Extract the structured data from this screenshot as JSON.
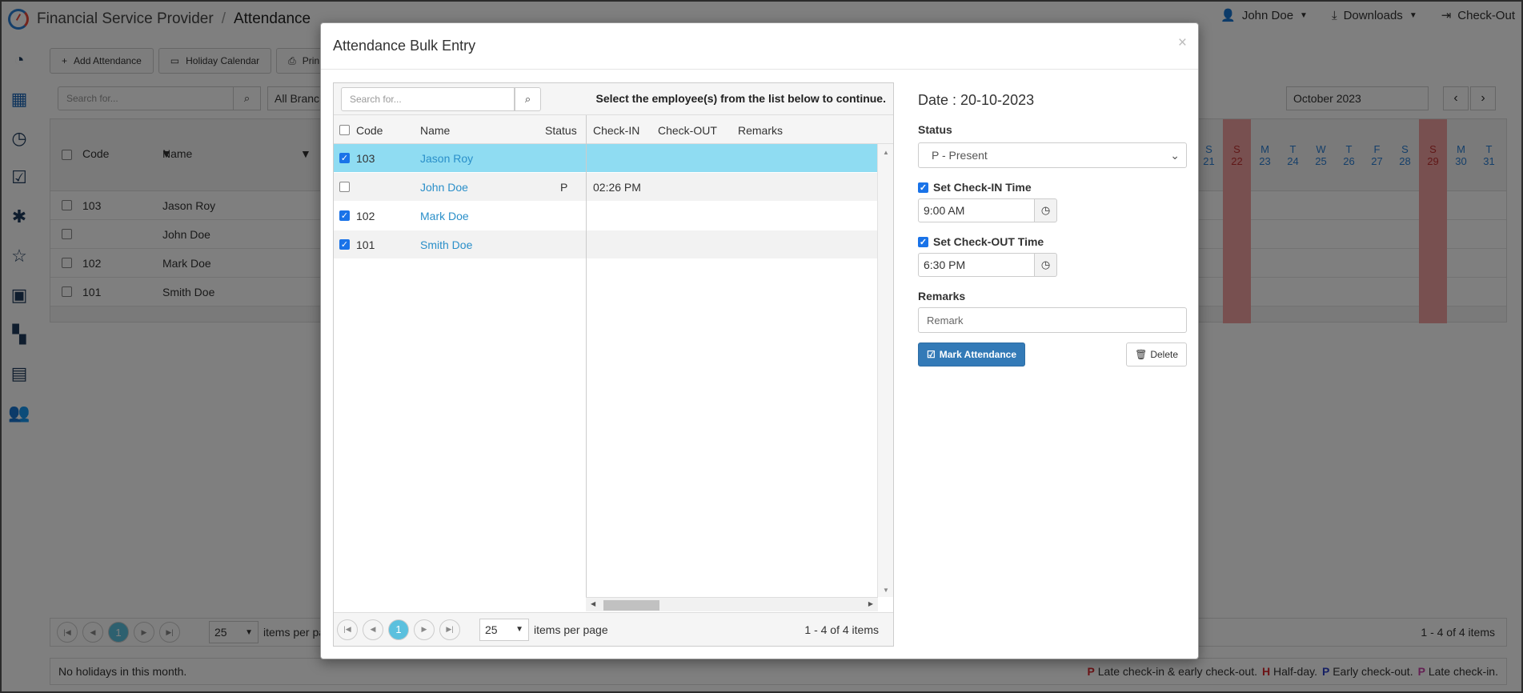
{
  "app": {
    "name": "Financial Service Provider",
    "page": "Attendance",
    "user": "John Doe",
    "downloads": "Downloads",
    "checkout": "Check-Out"
  },
  "toolbar": {
    "add_attendance": "Add Attendance",
    "holiday_calendar": "Holiday Calendar",
    "print": "Prin"
  },
  "bg": {
    "search_placeholder": "Search for...",
    "branch": "All Branch",
    "month": "October 2023",
    "col_code": "Code",
    "col_name": "Name",
    "rows": [
      {
        "code": "103",
        "name": "Jason Roy"
      },
      {
        "code": "",
        "name": "John Doe"
      },
      {
        "code": "102",
        "name": "Mark Doe"
      },
      {
        "code": "101",
        "name": "Smith Doe"
      }
    ],
    "days": [
      {
        "dow": "S",
        "d": "21",
        "we": false
      },
      {
        "dow": "S",
        "d": "22",
        "we": true
      },
      {
        "dow": "M",
        "d": "23",
        "we": false
      },
      {
        "dow": "T",
        "d": "24",
        "we": false
      },
      {
        "dow": "W",
        "d": "25",
        "we": false
      },
      {
        "dow": "T",
        "d": "26",
        "we": false
      },
      {
        "dow": "F",
        "d": "27",
        "we": false
      },
      {
        "dow": "S",
        "d": "28",
        "we": false
      },
      {
        "dow": "S",
        "d": "29",
        "we": true
      },
      {
        "dow": "M",
        "d": "30",
        "we": false
      },
      {
        "dow": "T",
        "d": "31",
        "we": false
      }
    ],
    "page_size": "25",
    "items_per_page": "items per pa",
    "count": "1 - 4 of 4 items",
    "no_holidays": "No holidays in this month.",
    "legend": [
      {
        "letter": "P",
        "color": "#d9262c",
        "text": "Late check-in & early check-out."
      },
      {
        "letter": "H",
        "color": "#d9262c",
        "text": "Half-day."
      },
      {
        "letter": "P",
        "color": "#2a3fc9",
        "text": "Early check-out."
      },
      {
        "letter": "P",
        "color": "#c93fa6",
        "text": "Late check-in."
      }
    ]
  },
  "modal": {
    "title": "Attendance Bulk Entry",
    "close": "×",
    "search_placeholder": "Search for...",
    "instruction": "Select the employee(s) from the list below to continue.",
    "columns": {
      "code": "Code",
      "name": "Name",
      "status": "Status",
      "checkin": "Check-IN",
      "checkout": "Check-OUT",
      "remarks": "Remarks"
    },
    "rows": [
      {
        "checked": true,
        "code": "103",
        "name": "Jason Roy",
        "status": "",
        "checkin": "",
        "selected": true
      },
      {
        "checked": false,
        "code": "",
        "name": "John Doe",
        "status": "P",
        "checkin": "02:26 PM",
        "selected": false
      },
      {
        "checked": true,
        "code": "102",
        "name": "Mark Doe",
        "status": "",
        "checkin": "",
        "selected": false
      },
      {
        "checked": true,
        "code": "101",
        "name": "Smith Doe",
        "status": "",
        "checkin": "",
        "selected": false
      }
    ],
    "current_page": "1",
    "page_size": "25",
    "items_per_page": "items per page",
    "count": "1 - 4 of 4 items"
  },
  "form": {
    "date": "Date : 20-10-2023",
    "status_label": "Status",
    "status_value": "P - Present",
    "checkin_label": "Set Check-IN Time",
    "checkin_value": "9:00 AM",
    "checkout_label": "Set Check-OUT Time",
    "checkout_value": "6:30 PM",
    "remarks_label": "Remarks",
    "remarks_placeholder": "Remark",
    "mark_button": "Mark Attendance",
    "delete_button": "Delete"
  }
}
